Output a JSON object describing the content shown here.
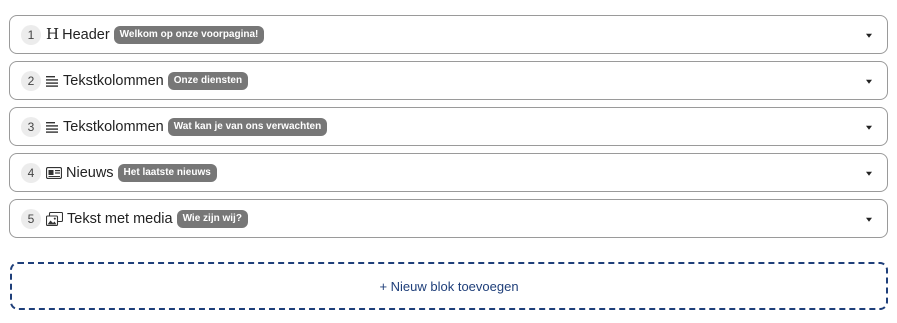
{
  "blocks": [
    {
      "number": "1",
      "icon": "heading-icon",
      "icon_glyph": "H",
      "title": "Header",
      "badge": "Welkom op onze voorpagina!"
    },
    {
      "number": "2",
      "icon": "text-columns-icon",
      "title": "Tekstkolommen",
      "badge": "Onze diensten"
    },
    {
      "number": "3",
      "icon": "text-columns-icon",
      "title": "Tekstkolommen",
      "badge": "Wat kan je van ons verwachten"
    },
    {
      "number": "4",
      "icon": "news-icon",
      "title": "Nieuws",
      "badge": "Het laatste nieuws"
    },
    {
      "number": "5",
      "icon": "media-icon",
      "title": "Tekst met media",
      "badge": "Wie zijn wij?"
    }
  ],
  "add_block": {
    "label": "+ Nieuw blok toevoegen"
  },
  "colors": {
    "badge_bg": "#777777",
    "add_block_accent": "#1f3f7a",
    "border": "#9a9a9a"
  }
}
